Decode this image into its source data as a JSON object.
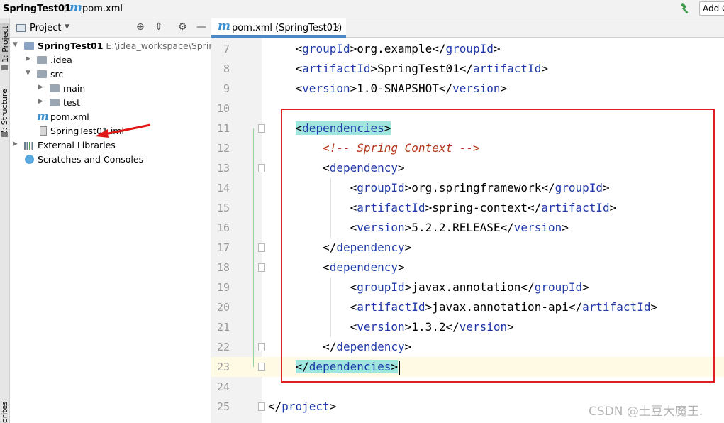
{
  "navbar": {
    "project": "SpringTest01",
    "separator": "〉",
    "file_icon": "m",
    "file": "pom.xml",
    "hammer_icon": "hammer-icon",
    "add_button": "Add C"
  },
  "toolstrip": {
    "project_tab": "1: Project",
    "structure_tab": "Z: Structure",
    "favorites_tab": "orites"
  },
  "project_panel": {
    "title": "Project",
    "tree": [
      {
        "name": "SpringTest01",
        "path": "E:\\idea_workspace\\SpringT"
      },
      {
        "name": ".idea"
      },
      {
        "name": "src"
      },
      {
        "name": "main"
      },
      {
        "name": "test"
      },
      {
        "name": "pom.xml"
      },
      {
        "name": "SpringTest01.iml"
      },
      {
        "name": "External Libraries"
      },
      {
        "name": "Scratches and Consoles"
      }
    ]
  },
  "editor": {
    "tab_label": "pom.xml (SpringTest01)",
    "tab_close": "×",
    "lines": [
      {
        "n": "7",
        "indent": "    ",
        "open": "groupId",
        "text": "org.example"
      },
      {
        "n": "8",
        "indent": "    ",
        "open": "artifactId",
        "text": "SpringTest01"
      },
      {
        "n": "9",
        "indent": "    ",
        "open": "version",
        "text": "1.0-SNAPSHOT"
      },
      {
        "n": "10",
        "indent": ""
      },
      {
        "n": "11",
        "indent": "    ",
        "tagline": "<dependencies>"
      },
      {
        "n": "12",
        "indent": "        ",
        "comment": "<!-- Spring Context -->"
      },
      {
        "n": "13",
        "indent": "        ",
        "tagline": "<dependency>"
      },
      {
        "n": "14",
        "indent": "            ",
        "open": "groupId",
        "text": "org.springframework"
      },
      {
        "n": "15",
        "indent": "            ",
        "open": "artifactId",
        "text": "spring-context"
      },
      {
        "n": "16",
        "indent": "            ",
        "open": "version",
        "text": "5.2.2.RELEASE"
      },
      {
        "n": "17",
        "indent": "        ",
        "tagline": "</dependency>"
      },
      {
        "n": "18",
        "indent": "        ",
        "tagline": "<dependency>"
      },
      {
        "n": "19",
        "indent": "            ",
        "open": "groupId",
        "text": "javax.annotation"
      },
      {
        "n": "20",
        "indent": "            ",
        "open": "artifactId",
        "text": "javax.annotation-api"
      },
      {
        "n": "21",
        "indent": "            ",
        "open": "version",
        "text": "1.3.2"
      },
      {
        "n": "22",
        "indent": "        ",
        "tagline": "</dependency>"
      },
      {
        "n": "23",
        "indent": "    ",
        "tagline": "</dependencies>"
      },
      {
        "n": "24",
        "indent": ""
      },
      {
        "n": "25",
        "indent": "",
        "tagline": "</project>"
      }
    ]
  },
  "watermark": "CSDN @土豆大魔王."
}
